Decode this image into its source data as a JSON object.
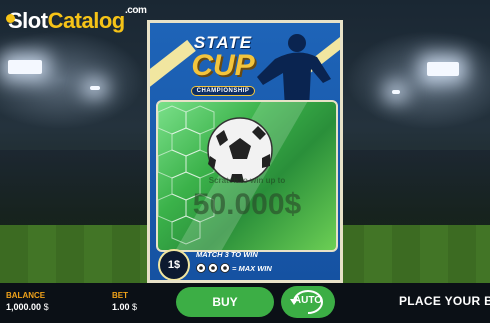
{
  "logo": {
    "part1": "Slot",
    "part2": "Catalog",
    "suffix": ".com"
  },
  "ticket": {
    "title_line1": "STATE",
    "title_line2": "CUP",
    "subtitle": "CHAMPIONSHIP",
    "prize_caption": "Scratch to win up to",
    "prize_amount": "50.000$",
    "price": "1$",
    "rule_line1": "MATCH 3 TO WIN",
    "rule_line2": "= MAX WIN"
  },
  "footer": {
    "balance_label": "BALANCE",
    "balance_value": "1,000.00",
    "balance_currency": "$",
    "bet_label": "BET",
    "bet_value": "1.00",
    "bet_currency": "$",
    "buy_label": "BUY",
    "auto_label": "AUTO",
    "message": "PLACE YOUR BET"
  },
  "colors": {
    "accent_green": "#3cae45",
    "label_orange": "#f0a21a",
    "logo_yellow": "#f6c317",
    "ticket_blue": "#1e64b8"
  },
  "icons": [
    "soccer-ball-icon",
    "auto-spin-icon"
  ]
}
